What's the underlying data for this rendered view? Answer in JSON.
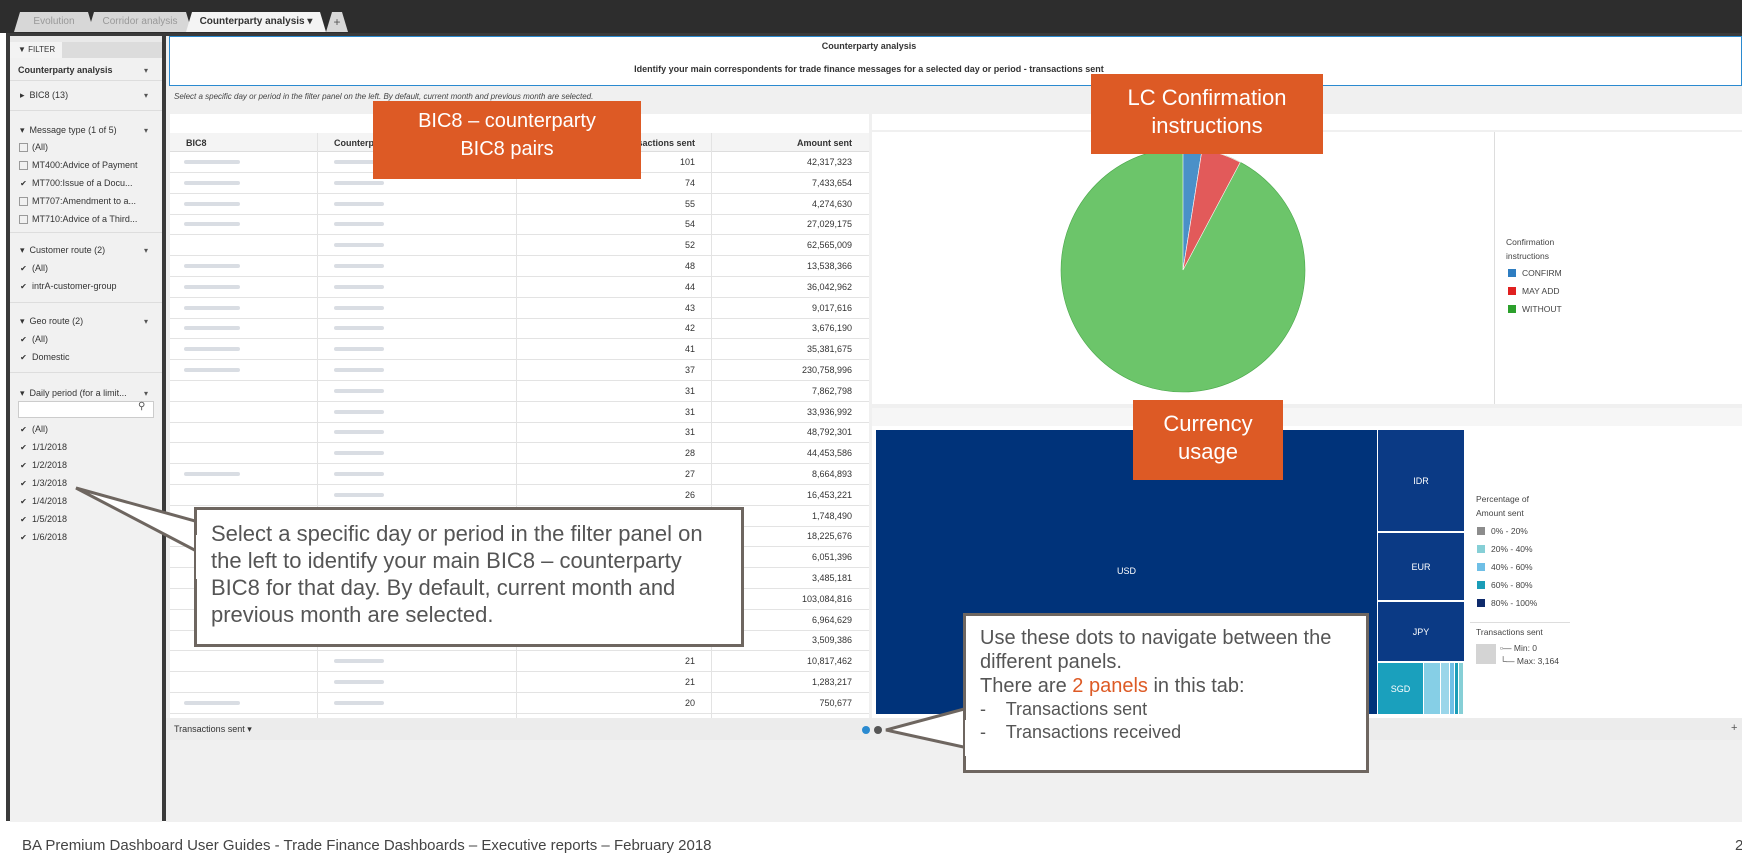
{
  "tabs": [
    {
      "label": "Evolution"
    },
    {
      "label": "Corridor analysis"
    },
    {
      "label": "Counterparty analysis",
      "arrow": "▾"
    },
    {
      "label": "+"
    }
  ],
  "filter": {
    "tab_label": "FILTER",
    "view_select": "Counterparty analysis",
    "bic8": "BIC8 (13)",
    "message_type": {
      "header": "Message type (1 of 5)",
      "items": [
        {
          "label": "(All)",
          "checked": false
        },
        {
          "label": "MT400:Advice of Payment",
          "checked": false
        },
        {
          "label": "MT700:Issue of a Docu...",
          "checked": true
        },
        {
          "label": "MT707:Amendment to a...",
          "checked": false
        },
        {
          "label": "MT710:Advice of a Third...",
          "checked": false
        }
      ]
    },
    "customer_route": {
      "header": "Customer route (2)",
      "items": [
        {
          "label": "(All)",
          "checked": true
        },
        {
          "label": "intrA-customer-group",
          "checked": true
        }
      ]
    },
    "geo_route": {
      "header": "Geo route (2)",
      "items": [
        {
          "label": "(All)",
          "checked": true
        },
        {
          "label": "Domestic",
          "checked": true
        }
      ]
    },
    "daily_period": {
      "header": "Daily period (for a limit...",
      "items": [
        {
          "label": "(All)",
          "checked": true
        },
        {
          "label": "1/1/2018",
          "checked": true
        },
        {
          "label": "1/2/2018",
          "checked": true
        },
        {
          "label": "1/3/2018",
          "checked": true
        },
        {
          "label": "1/4/2018",
          "checked": true
        },
        {
          "label": "1/5/2018",
          "checked": true
        },
        {
          "label": "1/6/2018",
          "checked": true
        }
      ]
    }
  },
  "header": {
    "title": "Counterparty analysis",
    "subtitle": "Identify your main correspondents for trade finance messages for a selected day or period - transactions sent",
    "hint": "Select a specific day or period in the filter panel on the left. By default, current month and previous month are selected."
  },
  "table": {
    "columns": [
      "BIC8",
      "Counterp",
      "Transactions sent",
      "Amount sent"
    ],
    "rows": [
      {
        "tx": "101",
        "amount": "42,317,323"
      },
      {
        "tx": "74",
        "amount": "7,433,654"
      },
      {
        "tx": "55",
        "amount": "4,274,630"
      },
      {
        "tx": "54",
        "amount": "27,029,175"
      },
      {
        "tx": "52",
        "amount": "62,565,009"
      },
      {
        "tx": "48",
        "amount": "13,538,366"
      },
      {
        "tx": "44",
        "amount": "36,042,962"
      },
      {
        "tx": "43",
        "amount": "9,017,616"
      },
      {
        "tx": "42",
        "amount": "3,676,190"
      },
      {
        "tx": "41",
        "amount": "35,381,675"
      },
      {
        "tx": "37",
        "amount": "230,758,996"
      },
      {
        "tx": "31",
        "amount": "7,862,798"
      },
      {
        "tx": "31",
        "amount": "33,936,992"
      },
      {
        "tx": "31",
        "amount": "48,792,301"
      },
      {
        "tx": "28",
        "amount": "44,453,586"
      },
      {
        "tx": "27",
        "amount": "8,664,893"
      },
      {
        "tx": "26",
        "amount": "16,453,221"
      },
      {
        "tx": "",
        "amount": "1,748,490"
      },
      {
        "tx": "",
        "amount": "18,225,676"
      },
      {
        "tx": "",
        "amount": "6,051,396"
      },
      {
        "tx": "",
        "amount": "3,485,181"
      },
      {
        "tx": "",
        "amount": "103,084,816"
      },
      {
        "tx": "",
        "amount": "6,964,629"
      },
      {
        "tx": "",
        "amount": "3,509,386"
      },
      {
        "tx": "21",
        "amount": "10,817,462"
      },
      {
        "tx": "21",
        "amount": "1,283,217"
      },
      {
        "tx": "20",
        "amount": "750,677"
      }
    ]
  },
  "pie": {
    "legend_title": [
      "Confirmation",
      "instructions"
    ],
    "legend": [
      {
        "label": "CONFIRM",
        "color": "#2e7dc1"
      },
      {
        "label": "MAY ADD",
        "color": "#e02020"
      },
      {
        "label": "WITHOUT",
        "color": "#2ca02c"
      }
    ],
    "slice_colors": {
      "confirm": "#4a90c8",
      "may_add": "#e25a5a",
      "without": "#6cc56a"
    }
  },
  "treemap": {
    "labels": {
      "usd": "USD",
      "idr": "IDR",
      "eur": "EUR",
      "jpy": "JPY",
      "sgd": "SGD"
    },
    "legend_title": [
      "Percentage of",
      "Amount sent"
    ],
    "legend": [
      {
        "label": "0% - 20%",
        "color": "#8c8c8c"
      },
      {
        "label": "20% - 40%",
        "color": "#86cfd6"
      },
      {
        "label": "40% - 60%",
        "color": "#6fbfe6"
      },
      {
        "label": "60% - 80%",
        "color": "#1a9db8"
      },
      {
        "label": "80% - 100%",
        "color": "#0e2a6b"
      }
    ],
    "size_title": "Transactions sent",
    "size_min": "Min: 0",
    "size_max": "Max: 3,164",
    "colors": {
      "usd": "#00337a",
      "idr": "#0b3a85",
      "eur": "#0b3a85",
      "jpy": "#0b3a85",
      "sgd": "#1aa0bd"
    }
  },
  "bottom": {
    "selector": "Transactions sent",
    "arrow": "▾",
    "plus": "+"
  },
  "dots": {
    "active": "#2a8ad0",
    "inactive": "#555555"
  },
  "callouts": {
    "bic8_pairs": [
      "BIC8 – counterparty",
      "BIC8 pairs"
    ],
    "lc_confirmation": [
      "LC Confirmation",
      "instructions"
    ],
    "currency_usage": [
      "Currency",
      "usage"
    ],
    "filter_help": "Select a specific day or period in the filter panel on the left to identify your main BIC8 – counterparty BIC8 for that day. By default, current month and previous month are selected.",
    "dots_help": {
      "line1": "Use these dots to navigate between the different panels.",
      "line2_pre": "There are ",
      "line2_highlight": "2 panels",
      "line2_post": " in this tab:",
      "items": [
        "Transactions sent",
        "Transactions received"
      ]
    }
  },
  "footer": {
    "text": "BA Premium Dashboard User Guides - Trade Finance Dashboards – Executive reports – February 2018",
    "page": "2"
  }
}
